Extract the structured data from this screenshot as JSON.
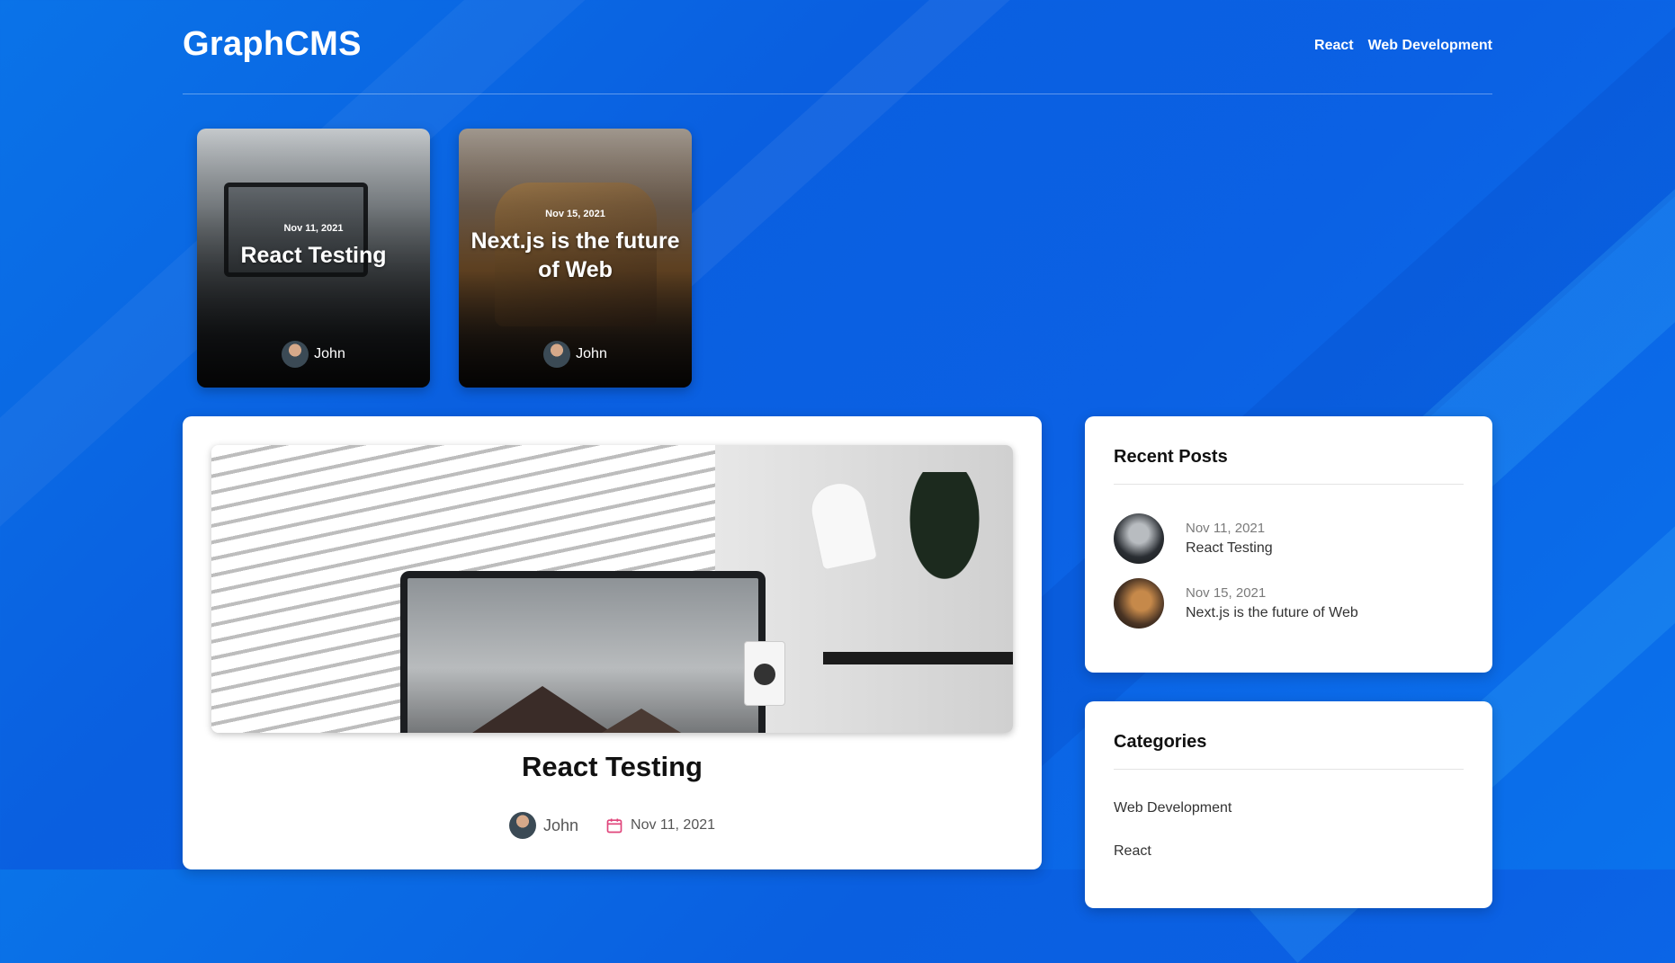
{
  "header": {
    "logo": "GraphCMS",
    "nav": [
      "React",
      "Web Development"
    ]
  },
  "featured_posts": [
    {
      "date": "Nov 11, 2021",
      "title": "React Testing",
      "author": "John"
    },
    {
      "date": "Nov 15, 2021",
      "title": "Next.js is the future of Web",
      "author": "John"
    }
  ],
  "post": {
    "title": "React Testing",
    "author": "John",
    "date": "Nov 11, 2021"
  },
  "recent_posts": {
    "title": "Recent Posts",
    "items": [
      {
        "date": "Nov 11, 2021",
        "title": "React Testing"
      },
      {
        "date": "Nov 15, 2021",
        "title": "Next.js is the future of Web"
      }
    ]
  },
  "categories": {
    "title": "Categories",
    "items": [
      "Web Development",
      "React"
    ]
  },
  "colors": {
    "background": "#0a63e4",
    "calendar_icon": "#e0457b"
  }
}
